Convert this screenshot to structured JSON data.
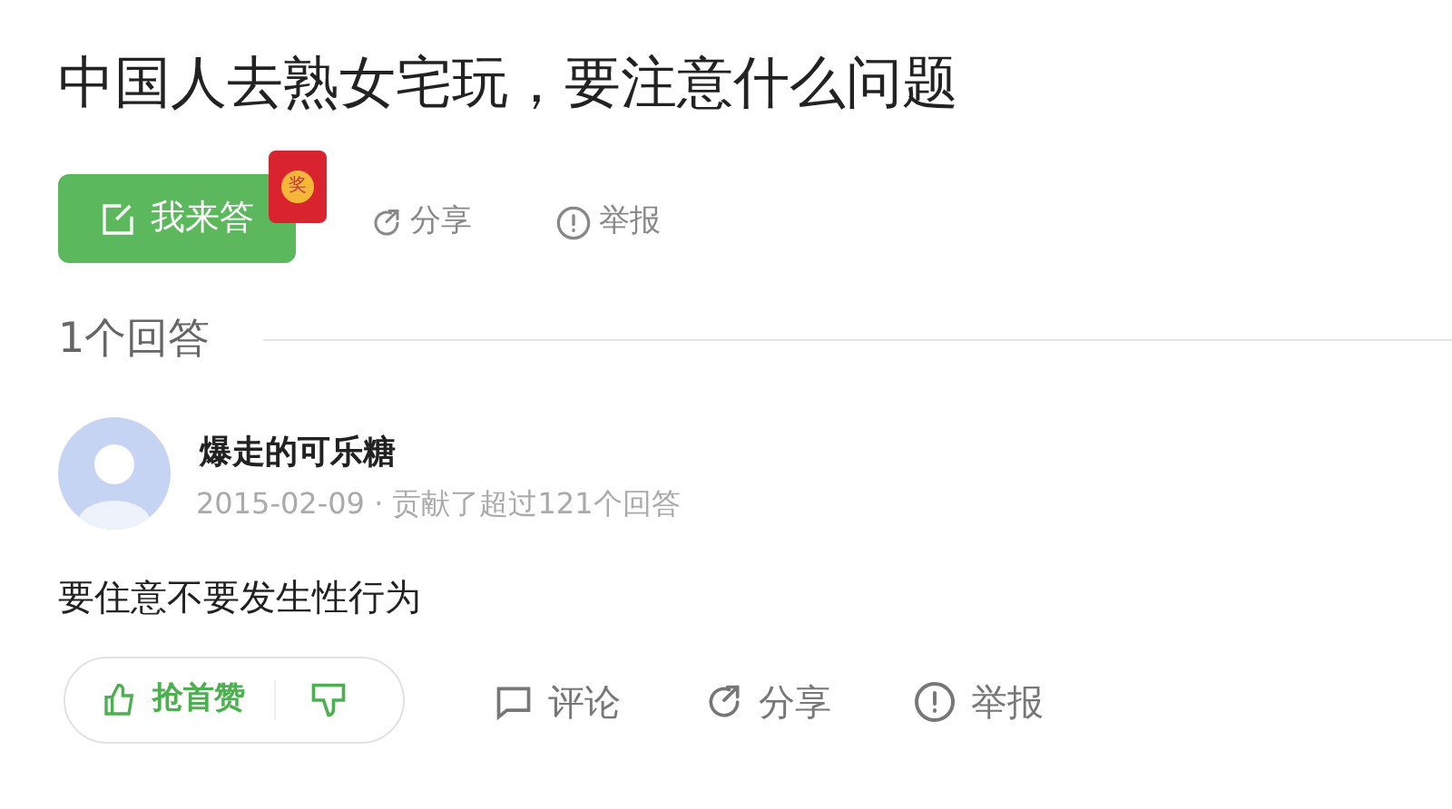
{
  "question": {
    "title": "中国人去熟女宅玩，要注意什么问题"
  },
  "actions": {
    "answer_button": "我来答",
    "reward_badge": "奖",
    "share": "分享",
    "report": "举报"
  },
  "answers_header": "1个回答",
  "answer": {
    "author": "爆走的可乐糖",
    "meta": "2015-02-09 · 贡献了超过121个回答",
    "text": "要住意不要发生性行为",
    "footer": {
      "like": "抢首赞",
      "comment": "评论",
      "share": "分享",
      "report": "举报"
    }
  }
}
